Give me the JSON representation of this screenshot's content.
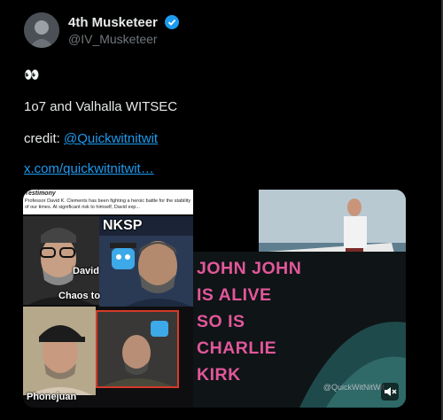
{
  "author": {
    "name": "4th Musketeer",
    "handle": "@IV_Musketeer"
  },
  "post": {
    "emoji": "👀",
    "line1": "1o7 and Valhalla WITSEC",
    "credit_label": "credit: ",
    "credit_mention": "@Quickwitnitwit",
    "link_text": "x.com/quickwitnitwit…"
  },
  "media": {
    "testimony_title": "Testimony",
    "testimony_body": "Professor David K. Clements has been fighting a heroic battle for the stability of our times. At significant risk to himself, David exp...",
    "caption_david": "David",
    "caption_chaos": "Chaos to",
    "caption_nksp": "NKSP",
    "caption_phonejuan": "Phonejuan",
    "overlay_text": "JOHN JOHN\nIS ALIVE\nSO IS\nCHARLIE\nKIRK",
    "watermark": "@QuickWitNitWit",
    "colors": {
      "overlay": "#e2579a",
      "link": "#1d9bf0"
    }
  },
  "icons": [
    "verified-badge-icon",
    "mute-icon",
    "avatar"
  ]
}
